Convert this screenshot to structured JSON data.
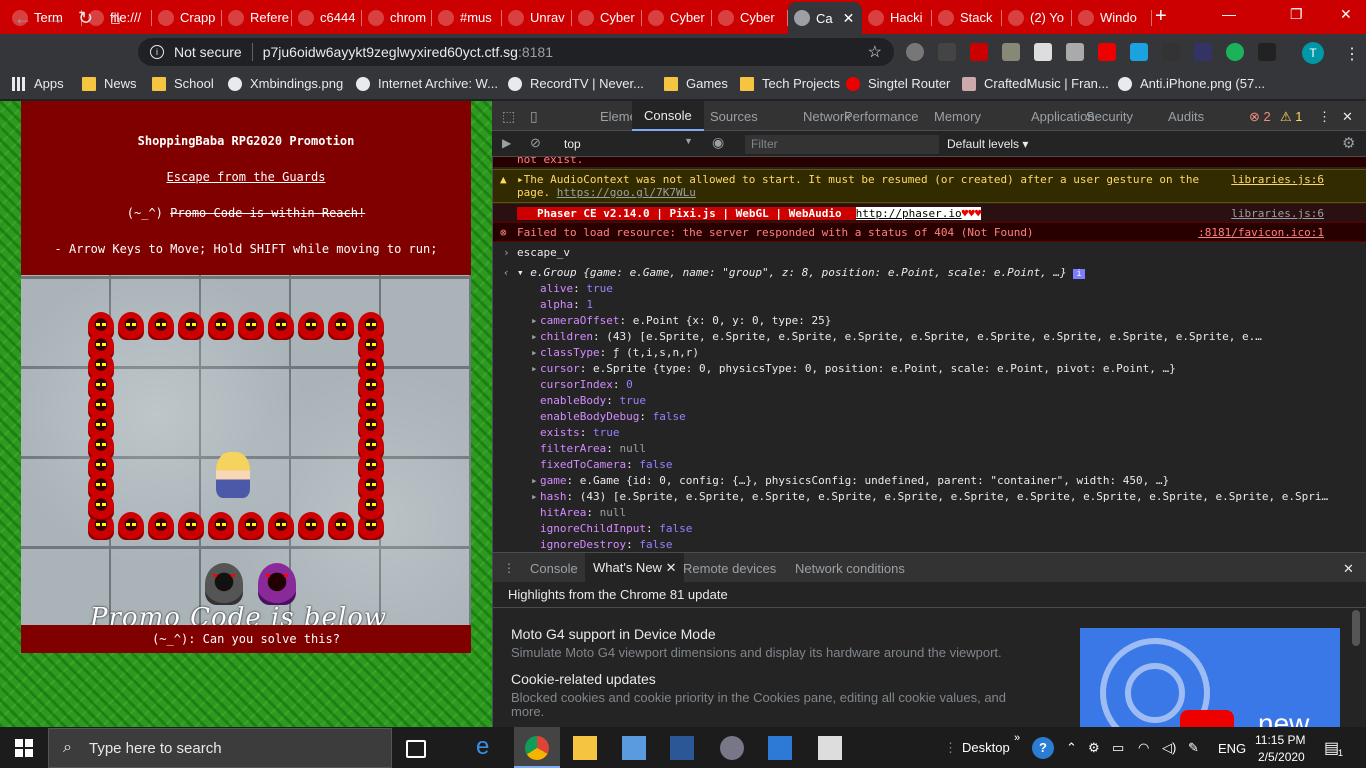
{
  "tabs": [
    {
      "label": "Term",
      "icon": "terminal-icon",
      "color": "#ffffff"
    },
    {
      "label": "file:///",
      "icon": "file-icon",
      "color": "#cc0000"
    },
    {
      "label": "Crapp",
      "icon": "globe-icon",
      "color": "#cc0000"
    },
    {
      "label": "Refere",
      "icon": "wix-icon",
      "color": "#000000"
    },
    {
      "label": "c6444",
      "icon": "drive-icon",
      "color": "#cc0000"
    },
    {
      "label": "chrom",
      "icon": "globe-icon",
      "color": "#cc0000"
    },
    {
      "label": "#mus",
      "icon": "hashtag-icon",
      "color": "#3f51b5"
    },
    {
      "label": "Unrav",
      "icon": "globe-icon",
      "color": "#cc0000"
    },
    {
      "label": "Cyber",
      "icon": "github-icon",
      "color": "#cc0000"
    },
    {
      "label": "Cyber",
      "icon": "shield-icon",
      "color": "#cc0000"
    },
    {
      "label": "Cyber",
      "icon": "shield-icon",
      "color": "#cc0000"
    },
    {
      "label": "Ca",
      "icon": "globe-icon",
      "color": "#35363a"
    },
    {
      "label": "Hacki",
      "icon": "github-icon",
      "color": "#cc0000"
    },
    {
      "label": "Stack",
      "icon": "stack-icon",
      "color": "#cc0000"
    },
    {
      "label": "(2) Yo",
      "icon": "youtube-icon",
      "color": "#cc0000"
    },
    {
      "label": "Windo",
      "icon": "globe-icon",
      "color": "#cc0000"
    }
  ],
  "address": {
    "security": "Not secure",
    "url": "p7ju6oidw6ayykt9zeglwyxired60yct.ctf.sg",
    "port": ":8181"
  },
  "profile_initial": "T",
  "bookmarks": [
    "Apps",
    "News",
    "School",
    "Xmbindings.png",
    "Internet Archive: W...",
    "RecordTV | Never...",
    "Games",
    "Tech Projects",
    "Singtel Router",
    "CraftedMusic | Fran...",
    "Anti.iPhone.png (57..."
  ],
  "game": {
    "title": "ShoppingBaba RPG2020 Promotion",
    "subtitle": "Escape from the Guards",
    "emote": "(~_^)",
    "struck": "Promo Code is within Reach!",
    "hint": "- Arrow Keys to Move; Hold SHIFT while moving to run;",
    "promo_text": "Promo Code is below",
    "footer": "(~_^): Can you solve this?"
  },
  "devtools": {
    "tabs": [
      "Elements",
      "Console",
      "Sources",
      "Network",
      "Performance",
      "Memory",
      "Application",
      "Security",
      "Audits"
    ],
    "errors": "2",
    "warnings": "1",
    "context": "top",
    "filter_placeholder": "Filter",
    "levels": "Default levels",
    "log": {
      "top_cut": "not exist.",
      "warn": "The AudioContext was not allowed to start. It must be resumed (or created) after a user gesture on the",
      "warn2": "page.",
      "warn_link": "https://goo.gl/7K7WLu",
      "warn_src": "libraries.js:6",
      "phaser": "Phaser CE v2.14.0 | Pixi.js | WebGL | WebAudio",
      "phaser_link": "http://phaser.io",
      "phaser_hearts": "♥♥♥",
      "phaser_src": "libraries.js:6",
      "error": "Failed to load resource: the server responded with a status of 404 (Not Found)",
      "error_src": ":8181/favicon.ico:1",
      "cmd": "escape_v",
      "obj": "e.Group {game: e.Game, name: \"group\", z: 8, position: e.Point, scale: e.Point, …}",
      "props": [
        {
          "k": "alive",
          "v": "true"
        },
        {
          "k": "alpha",
          "v": "1"
        },
        {
          "k": "cameraOffset",
          "v": "e.Point {x: 0, y: 0, type: 25}"
        },
        {
          "k": "children",
          "v": "(43) [e.Sprite, e.Sprite, e.Sprite, e.Sprite, e.Sprite, e.Sprite, e.Sprite, e.Sprite, e.Sprite, e.…"
        },
        {
          "k": "classType",
          "v": "ƒ (t,i,s,n,r)"
        },
        {
          "k": "cursor",
          "v": "e.Sprite {type: 0, physicsType: 0, position: e.Point, scale: e.Point, pivot: e.Point, …}"
        },
        {
          "k": "cursorIndex",
          "v": "0"
        },
        {
          "k": "enableBody",
          "v": "true"
        },
        {
          "k": "enableBodyDebug",
          "v": "false"
        },
        {
          "k": "exists",
          "v": "true"
        },
        {
          "k": "filterArea",
          "v": "null"
        },
        {
          "k": "fixedToCamera",
          "v": "false"
        },
        {
          "k": "game",
          "v": "e.Game {id: 0, config: {…}, physicsConfig: undefined, parent: \"container\", width: 450, …}"
        },
        {
          "k": "hash",
          "v": "(43) [e.Sprite, e.Sprite, e.Sprite, e.Sprite, e.Sprite, e.Sprite, e.Sprite, e.Sprite, e.Sprite, e.Sprite, e.Spri…"
        },
        {
          "k": "hitArea",
          "v": "null"
        },
        {
          "k": "ignoreChildInput",
          "v": "false"
        },
        {
          "k": "ignoreDestroy",
          "v": "false"
        }
      ]
    },
    "drawer_tabs": [
      "Console",
      "What's New",
      "Remote devices",
      "Network conditions"
    ],
    "whats_new": {
      "header": "Highlights from the Chrome 81 update",
      "items": [
        {
          "title": "Moto G4 support in Device Mode",
          "desc": "Simulate Moto G4 viewport dimensions and display its hardware around the viewport."
        },
        {
          "title": "Cookie-related updates",
          "desc": "Blocked cookies and cookie priority in the Cookies pane, editing all cookie values, and more."
        }
      ],
      "thumb_label": "new"
    }
  },
  "taskbar": {
    "search_placeholder": "Type here to search",
    "desktop": "Desktop",
    "lang": "ENG",
    "time": "11:15 PM",
    "date": "2/5/2020",
    "notifications": "1"
  }
}
